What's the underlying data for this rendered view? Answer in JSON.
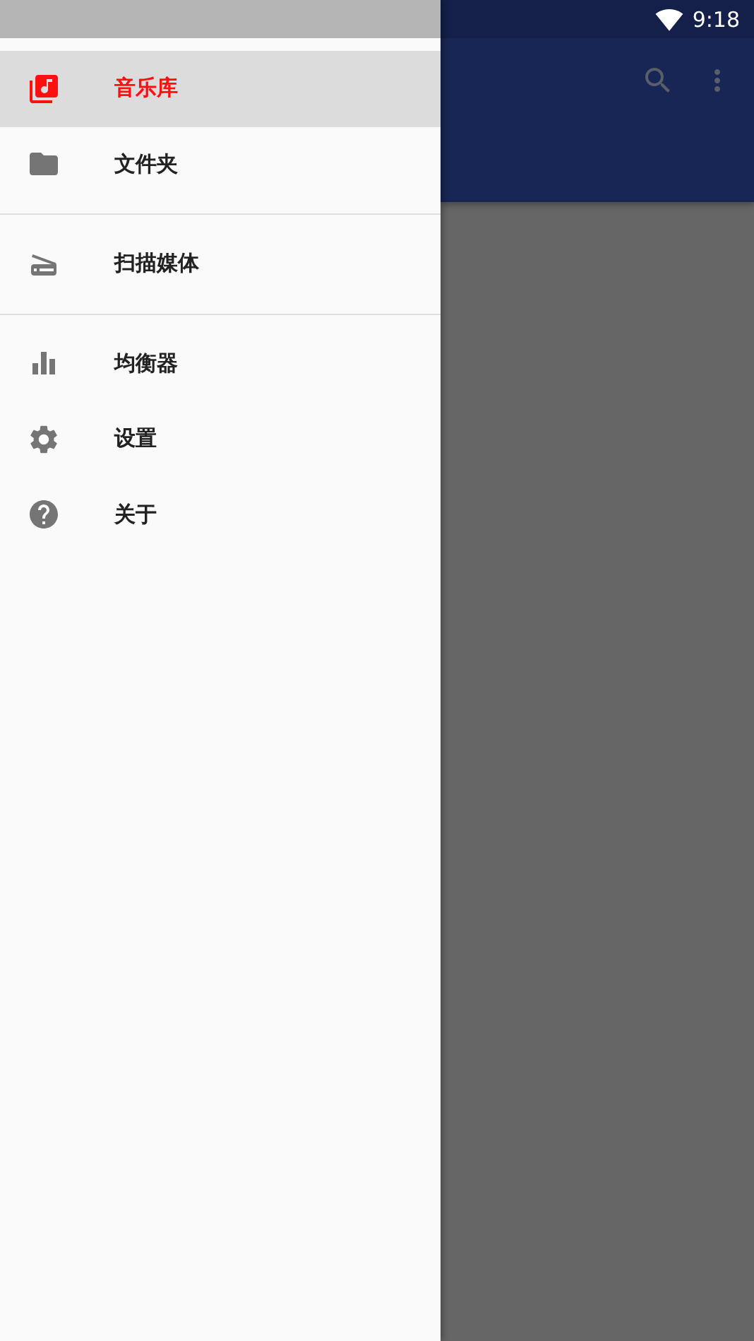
{
  "status_bar": {
    "time": "9:18"
  },
  "drawer": {
    "sections": [
      {
        "items": [
          {
            "label": "音乐库",
            "selected": true
          },
          {
            "label": "文件夹",
            "selected": false
          }
        ]
      },
      {
        "items": [
          {
            "label": "扫描媒体",
            "selected": false
          }
        ]
      },
      {
        "items": [
          {
            "label": "均衡器",
            "selected": false
          },
          {
            "label": "设置",
            "selected": false
          },
          {
            "label": "关于",
            "selected": false
          }
        ]
      }
    ]
  }
}
